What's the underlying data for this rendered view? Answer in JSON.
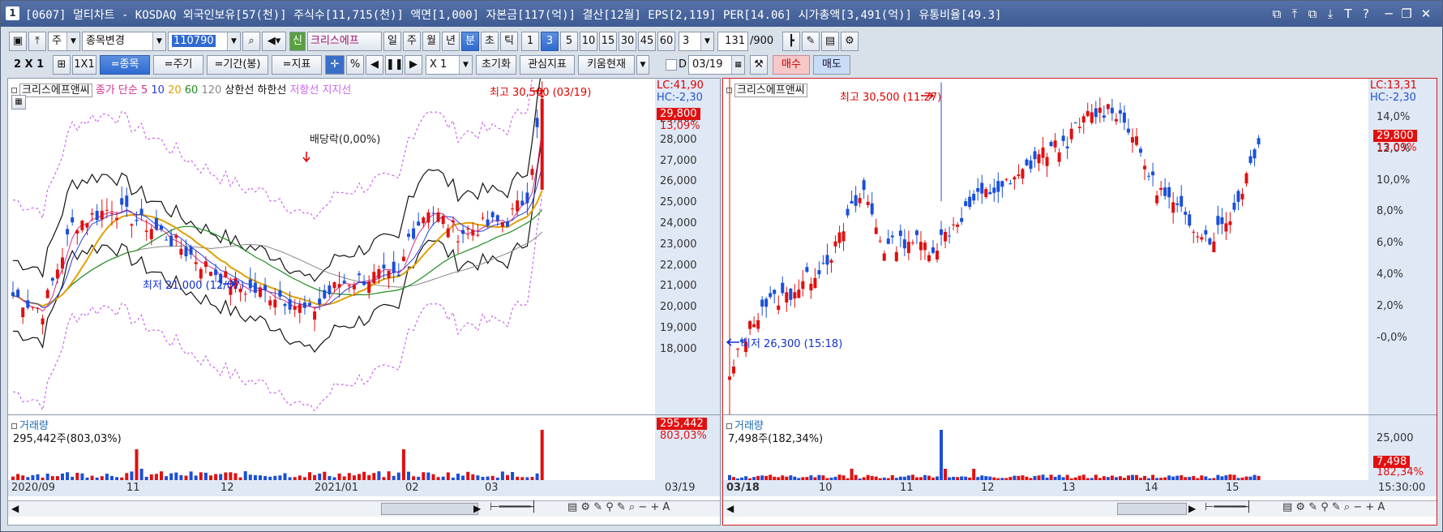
{
  "window": {
    "number": "1",
    "title": "[0607] 멀티차트 - KOSDAQ 외국인보유[57(천)] 주식수[11,715(천)] 액면[1,000] 자본금[117(억)] 결산[12월] EPS[2,119] PER[14.06] 시가총액[3,491(억)] 유통비율[49.3]",
    "controls": [
      "⧉",
      "⤒",
      "⧉",
      "⤓",
      "T",
      "?",
      "─",
      "❐",
      "✕"
    ]
  },
  "toolbar1": {
    "unit": "주",
    "stock_change": "종목변경",
    "code": "110790",
    "shin": "신",
    "stock_name": "크리스에프",
    "periods": [
      "일",
      "주",
      "월",
      "년",
      "분",
      "초",
      "틱"
    ],
    "active_period": "분",
    "intervals": [
      "1",
      "3",
      "5",
      "10",
      "15",
      "30",
      "45",
      "60"
    ],
    "active_interval": "3",
    "interval_value": "3",
    "count": "131",
    "count_total": "/900"
  },
  "toolbar2": {
    "layout": "2 X 1",
    "one": "1X1",
    "btn_stock": "=종목",
    "btn_cycle": "=주기",
    "btn_period": "=기간(봉)",
    "btn_index": "=지표",
    "pct": "%",
    "multiplier": "X 1",
    "reset": "초기화",
    "fav_index": "관심지표",
    "kiwoom": "키움현재",
    "d_label": "D",
    "date": "03/19",
    "buy": "매수",
    "sell": "매도"
  },
  "left": {
    "stock_name": "크리스에프앤씨",
    "legend": [
      {
        "text": "종가",
        "color": "#d1308f"
      },
      {
        "text": "단순",
        "color": "#d1308f"
      },
      {
        "text": "5",
        "color": "#d1308f"
      },
      {
        "text": "10",
        "color": "#2a40d8"
      },
      {
        "text": "20",
        "color": "#e0a000"
      },
      {
        "text": "60",
        "color": "#228b22"
      },
      {
        "text": "120",
        "color": "#888888"
      },
      {
        "text": "상한선",
        "color": "#111111"
      },
      {
        "text": "하한선",
        "color": "#111111"
      },
      {
        "text": "저항선",
        "color": "#cc66ee"
      },
      {
        "text": "지지선",
        "color": "#cc66ee"
      }
    ],
    "lc": "LC:41,90",
    "hc": "HC:-2,30",
    "price_chip": "29,800",
    "pct_chip": "13,09%",
    "yticks": [
      "29,000",
      "28,000",
      "27,000",
      "26,000",
      "25,000",
      "24,000",
      "23,000",
      "22,000",
      "21,000",
      "20,000",
      "19,000",
      "18,000"
    ],
    "high_label": "최고 30,500 (03/19)",
    "low_label": "최저 21,000 (12/07)",
    "dividend_label": "배당락(0,00%)",
    "volume_title": "거래량",
    "volume_text": "295,442주(803,03%)",
    "vol_chip": "295,442",
    "vol_pct_chip": "803,03%",
    "xlabels": [
      "2020/09",
      "11",
      "12",
      "2021/01",
      "02",
      "03"
    ],
    "x_right": "03/19"
  },
  "right": {
    "stock_name": "크리스에프앤씨",
    "lc": "LC:13,31",
    "hc": "HC:-2,30",
    "price_chip": "29,800",
    "pct_chip": "13,09%",
    "yticks": [
      "14,0%",
      "12,0%",
      "10,0%",
      "8,0%",
      "6,0%",
      "4,0%",
      "2,0%",
      "-0,0%"
    ],
    "high_label": "최고 30,500 (11:27)",
    "low_label": "최저 26,300 (15:18)",
    "volume_title": "거래량",
    "volume_text": "7,498주(182,34%)",
    "vol_tick": "25,000",
    "vol_chip": "7,498",
    "vol_pct_chip": "182,34%",
    "xlabels": [
      "03/18",
      "10",
      "11",
      "12",
      "13",
      "14",
      "15"
    ],
    "x_right": "15:30:00"
  },
  "chart_data": [
    {
      "type": "candlestick",
      "title": "크리스에프앤씨",
      "y_unit": "KRW",
      "ylim": [
        18000,
        30500
      ],
      "high": 30500,
      "high_date": "03/19",
      "low": 21000,
      "low_date": "12/07",
      "last": 29800,
      "change_pct": 13.09
    },
    {
      "type": "candlestick",
      "title": "크리스에프앤씨",
      "y_unit": "%",
      "ylim": [
        -1,
        15
      ],
      "high": 30500,
      "high_time": "11:27",
      "low": 26300,
      "low_time": "15:18",
      "last": 29800,
      "change_pct": 13.09
    }
  ]
}
